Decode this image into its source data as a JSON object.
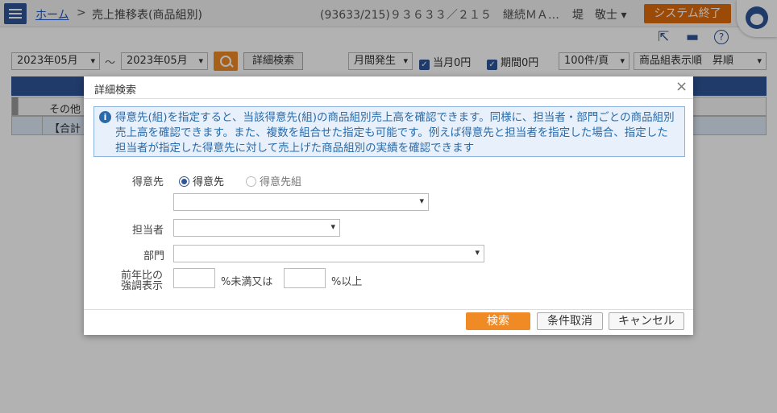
{
  "header": {
    "breadcrumb_home": "ホーム",
    "breadcrumb_sep": ">",
    "breadcrumb_current": "売上推移表(商品組別)",
    "company": "(93633/215)９３６３３／２１５　継続ＭＡ…",
    "user": "堤　敬士 ▾",
    "exit_label": "システム終了"
  },
  "toolbar": {
    "export_icon": "export-icon",
    "print_icon": "print-icon",
    "help_icon": "help-icon"
  },
  "filters": {
    "date_from": "2023年05月",
    "tilde": "～",
    "date_to": "2023年05月",
    "detail_search": "詳細検索",
    "occurrence": "月間発生",
    "chk_month_zero": "当月0円",
    "chk_period_zero": "期間0円",
    "per_page": "100件/頁",
    "sort": "商品組表示順　昇順"
  },
  "grid": {
    "row1": "その他",
    "row2": "【合計"
  },
  "modal": {
    "title": "詳細検索",
    "close": "×",
    "info_text": "得意先(組)を指定すると、当該得意先(組)の商品組別売上高を確認できます。同様に、担当者・部門ごとの商品組別売上高を確認できます。また、複数を組合せた指定も可能です。例えば得意先と担当者を指定した場合、指定した担当者が指定した得意先に対して売上げた商品組別の実績を確認できます",
    "customer_label": "得意先",
    "radio_customer": "得意先",
    "radio_customer_group": "得意先組",
    "staff_label": "担当者",
    "dept_label": "部門",
    "compare_label_1": "前年比の",
    "compare_label_2": "強調表示",
    "below_text": "%未満又は",
    "above_text": "%以上",
    "btn_search": "検索",
    "btn_clear": "条件取消",
    "btn_cancel": "キャンセル"
  },
  "colors": {
    "accent": "#2f5597",
    "orange": "#f08a24"
  }
}
